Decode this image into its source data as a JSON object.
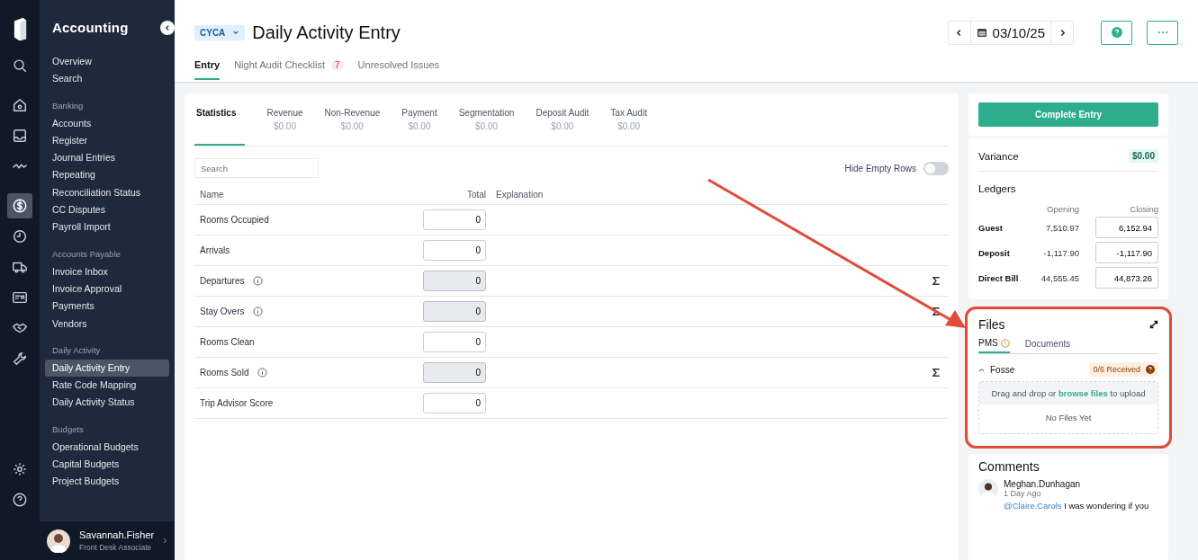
{
  "app": {
    "title": "Accounting"
  },
  "rail": [
    {
      "selected": false
    },
    {
      "selected": false
    },
    {
      "selected": false
    },
    {
      "selected": false
    },
    {
      "selected": true
    },
    {
      "selected": false
    },
    {
      "selected": false
    },
    {
      "selected": false
    },
    {
      "selected": false
    },
    {
      "selected": false
    }
  ],
  "nav": [
    {
      "items": [
        {
          "label": "Overview",
          "selected": false
        },
        {
          "label": "Search",
          "selected": false
        }
      ]
    },
    {
      "heading": "Banking",
      "items": [
        {
          "label": "Accounts",
          "selected": false
        },
        {
          "label": "Register",
          "selected": false
        },
        {
          "label": "Journal Entries",
          "selected": false
        },
        {
          "label": "Repeating",
          "selected": false
        },
        {
          "label": "Reconciliation Status",
          "selected": false
        },
        {
          "label": "CC Disputes",
          "selected": false
        },
        {
          "label": "Payroll Import",
          "selected": false
        }
      ]
    },
    {
      "heading": "Accounts Payable",
      "items": [
        {
          "label": "Invoice Inbox",
          "selected": false
        },
        {
          "label": "Invoice Approval",
          "selected": false
        },
        {
          "label": "Payments",
          "selected": false
        },
        {
          "label": "Vendors",
          "selected": false
        }
      ]
    },
    {
      "heading": "Daily Activity",
      "items": [
        {
          "label": "Daily Activity Entry",
          "selected": true
        },
        {
          "label": "Rate Code Mapping",
          "selected": false
        },
        {
          "label": "Daily Activity Status",
          "selected": false
        }
      ]
    },
    {
      "heading": "Budgets",
      "items": [
        {
          "label": "Operational Budgets",
          "selected": false
        },
        {
          "label": "Capital Budgets",
          "selected": false
        },
        {
          "label": "Project Budgets",
          "selected": false
        }
      ]
    }
  ],
  "user": {
    "name": "Savannah.Fisher",
    "role": "Front Desk Associate"
  },
  "header": {
    "property": "CYCA",
    "title": "Daily Activity Entry",
    "date": "03/10/25"
  },
  "tabs": [
    {
      "label": "Entry",
      "selected": true
    },
    {
      "label": "Night Audit Checklist",
      "badge": "7",
      "selected": false
    },
    {
      "label": "Unresolved Issues",
      "selected": false
    }
  ],
  "sections": [
    {
      "label": "Statistics",
      "selected": true
    },
    {
      "label": "Revenue",
      "amount": "$0.00",
      "selected": false
    },
    {
      "label": "Non-Revenue",
      "amount": "$0.00",
      "selected": false
    },
    {
      "label": "Payment",
      "amount": "$0.00",
      "selected": false
    },
    {
      "label": "Segmentation",
      "amount": "$0.00",
      "selected": false
    },
    {
      "label": "Deposit Audit",
      "amount": "$0.00",
      "selected": false
    },
    {
      "label": "Tax Audit",
      "amount": "$0.00",
      "selected": false
    }
  ],
  "search": {
    "placeholder": "Search"
  },
  "hide_empty_rows": {
    "label": "Hide Empty Rows",
    "on": false
  },
  "table": {
    "columns": [
      "Name",
      "Total",
      "Explanation"
    ],
    "rows": [
      {
        "name": "Rooms Occupied",
        "total": "0",
        "info": false,
        "calculated": false
      },
      {
        "name": "Arrivals",
        "total": "0",
        "info": false,
        "calculated": false
      },
      {
        "name": "Departures",
        "total": "0",
        "info": true,
        "calculated": true
      },
      {
        "name": "Stay Overs",
        "total": "0",
        "info": true,
        "calculated": true
      },
      {
        "name": "Rooms Clean",
        "total": "0",
        "info": false,
        "calculated": false
      },
      {
        "name": "Rooms Sold",
        "total": "0",
        "info": true,
        "calculated": true
      },
      {
        "name": "Trip Advisor Score",
        "total": "0",
        "info": false,
        "calculated": false
      }
    ]
  },
  "complete_button": "Complete Entry",
  "variance": {
    "label": "Variance",
    "amount": "$0.00"
  },
  "ledgers": {
    "title": "Ledgers",
    "columns": [
      "Opening",
      "Closing"
    ],
    "rows": [
      {
        "name": "Guest",
        "opening": "7,510.97",
        "closing": "6,152.94"
      },
      {
        "name": "Deposit",
        "opening": "-1,117.90",
        "closing": "-1,117.90"
      },
      {
        "name": "Direct Bill",
        "opening": "44,555.45",
        "closing": "44,873.26"
      }
    ]
  },
  "files": {
    "title": "Files",
    "highlighted": true,
    "tabs": [
      {
        "label": "PMS",
        "warning": true,
        "selected": true
      },
      {
        "label": "Documents",
        "warning": false,
        "selected": false
      }
    ],
    "group": {
      "name": "Fosse",
      "expanded": true,
      "status": "0/6 Received"
    },
    "dropzone": {
      "before": "Drag and drop or",
      "link": "browse files",
      "after": "to upload"
    },
    "empty": "No Files Yet"
  },
  "comments": {
    "title": "Comments",
    "items": [
      {
        "author": "Meghan.Dunhagan",
        "time": "1 Day Ago",
        "mention": "@Claire.Carols",
        "text": "I was wondering if you"
      }
    ]
  }
}
